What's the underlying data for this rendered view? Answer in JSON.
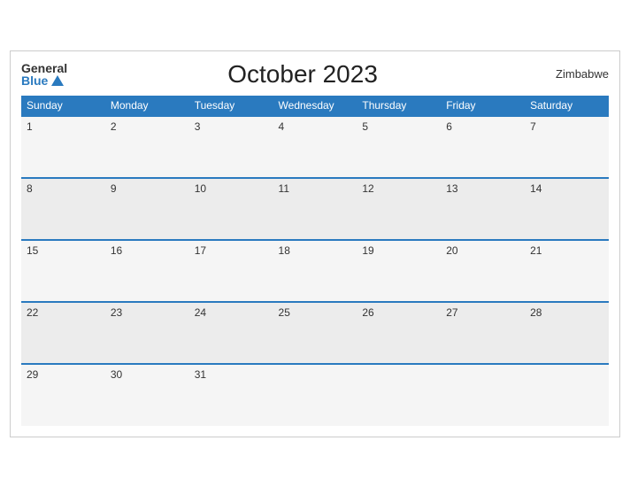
{
  "header": {
    "logo_general": "General",
    "logo_blue": "Blue",
    "title": "October 2023",
    "country": "Zimbabwe"
  },
  "weekdays": [
    "Sunday",
    "Monday",
    "Tuesday",
    "Wednesday",
    "Thursday",
    "Friday",
    "Saturday"
  ],
  "weeks": [
    [
      {
        "day": "1"
      },
      {
        "day": "2"
      },
      {
        "day": "3"
      },
      {
        "day": "4"
      },
      {
        "day": "5"
      },
      {
        "day": "6"
      },
      {
        "day": "7"
      }
    ],
    [
      {
        "day": "8"
      },
      {
        "day": "9"
      },
      {
        "day": "10"
      },
      {
        "day": "11"
      },
      {
        "day": "12"
      },
      {
        "day": "13"
      },
      {
        "day": "14"
      }
    ],
    [
      {
        "day": "15"
      },
      {
        "day": "16"
      },
      {
        "day": "17"
      },
      {
        "day": "18"
      },
      {
        "day": "19"
      },
      {
        "day": "20"
      },
      {
        "day": "21"
      }
    ],
    [
      {
        "day": "22"
      },
      {
        "day": "23"
      },
      {
        "day": "24"
      },
      {
        "day": "25"
      },
      {
        "day": "26"
      },
      {
        "day": "27"
      },
      {
        "day": "28"
      }
    ],
    [
      {
        "day": "29"
      },
      {
        "day": "30"
      },
      {
        "day": "31"
      },
      {
        "day": ""
      },
      {
        "day": ""
      },
      {
        "day": ""
      },
      {
        "day": ""
      }
    ]
  ]
}
